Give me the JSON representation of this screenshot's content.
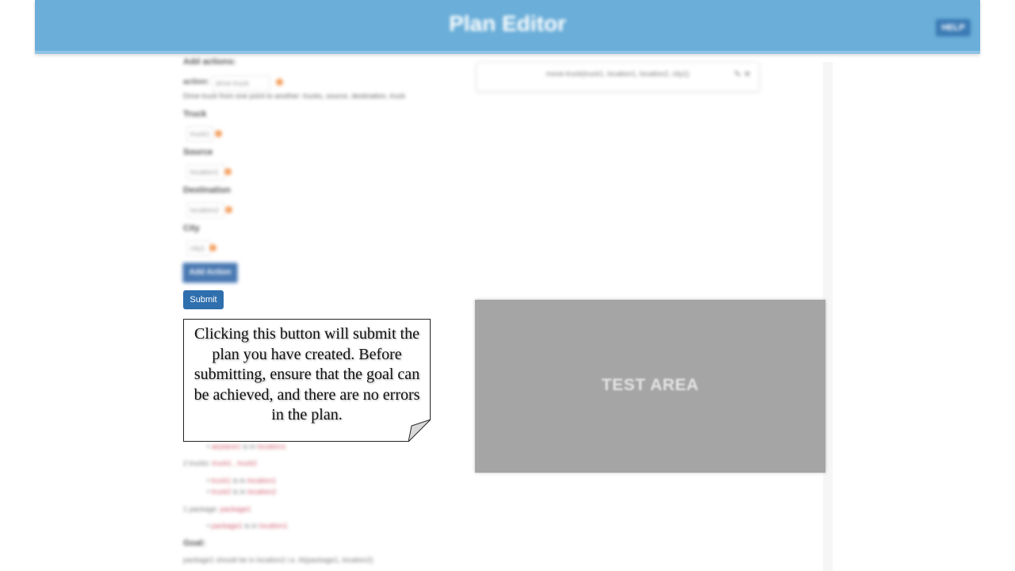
{
  "header": {
    "title": "Plan Editor",
    "help_label": "HELP"
  },
  "actions_panel": {
    "title": "Add actions:",
    "action_label": "action:",
    "action_value": "drive-truck",
    "action_description": "Drive truck from one point to another: trucks, source, destination, truck",
    "fields": [
      {
        "label": "Truck",
        "value": "truck1"
      },
      {
        "label": "Source",
        "value": "location1"
      },
      {
        "label": "Destination",
        "value": "location2"
      },
      {
        "label": "City",
        "value": "city1"
      }
    ],
    "add_action_label": "Add Action"
  },
  "submit_label": "Submit",
  "tooltip": {
    "text": "Clicking this button will submit the plan you have created. Before submitting, ensure that the goal can be achieved, and there are no errors in the plan."
  },
  "state": {
    "lines": [
      {
        "a": "airplane1",
        "b": "location1"
      },
      {
        "heading": "2 trucks:",
        "items": "truck1 , truck2"
      },
      {
        "a": "truck1",
        "b": "location1"
      },
      {
        "a": "truck2",
        "b": "location2"
      },
      {
        "heading": "1 package:",
        "items": "package1"
      },
      {
        "a": "package1",
        "b": "location1"
      }
    ],
    "at_label": "is in",
    "goal_title": "Goal:",
    "goal_text": "package1 should be in location2 i.e. At(package1, location2)"
  },
  "plan": {
    "step": "move-truck(truck1, location1, location2, city1)",
    "edit_icon": "pencil-icon",
    "delete_icon": "close-icon"
  },
  "test_area": {
    "label": "TEST AREA"
  },
  "colors": {
    "header": "#6aaed9",
    "submit": "#2f6fae",
    "add_action": "#4a79b2",
    "dot": "#f4a060",
    "test_area": "#a5a5a5"
  }
}
